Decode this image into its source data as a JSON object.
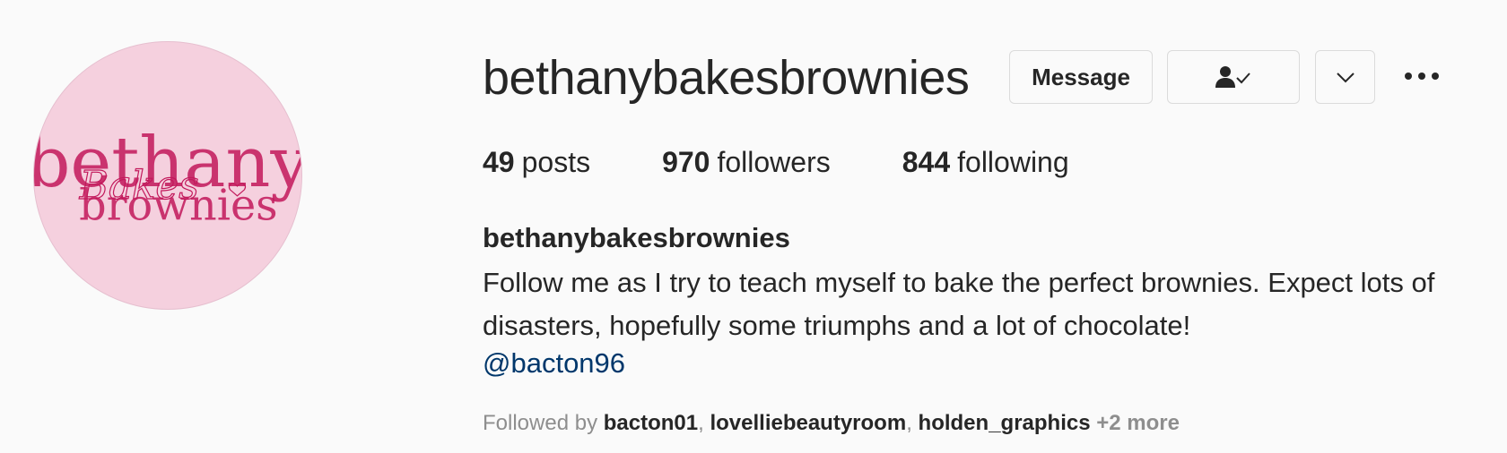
{
  "profile": {
    "avatar_text": {
      "line1": "bethany",
      "script": "Bakes",
      "line2": "brownies"
    },
    "username": "bethanybakesbrownies",
    "buttons": {
      "message": "Message",
      "following_icon": "person-check-icon",
      "suggest_icon": "chevron-down-icon",
      "options_icon": "more-options-icon"
    }
  },
  "stats": [
    {
      "value": "49",
      "label": "posts"
    },
    {
      "value": "970",
      "label": "followers"
    },
    {
      "value": "844",
      "label": "following"
    }
  ],
  "bio": {
    "full_name": "bethanybakesbrownies",
    "text": "Follow me as I try to teach myself to bake the perfect brownies. Expect lots of disasters, hopefully some triumphs and a lot of chocolate!",
    "mention": "@bacton96"
  },
  "followed_by": {
    "prefix": "Followed by",
    "accounts": [
      "bacton01",
      "lovelliebeautyroom",
      "holden_graphics"
    ],
    "more": "+2 more"
  },
  "colors": {
    "avatar_bg": "#f5d0de",
    "brand_pink": "#c2185b",
    "link": "#00376b",
    "muted": "#8e8e8e"
  }
}
